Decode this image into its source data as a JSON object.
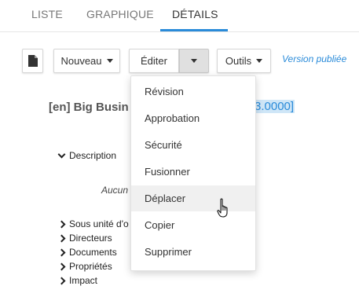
{
  "tabs": [
    {
      "label": "LISTE"
    },
    {
      "label": "GRAPHIQUE"
    },
    {
      "label": "DÉTAILS",
      "active": true
    }
  ],
  "toolbar": {
    "doc_icon": "document-icon",
    "new_label": "Nouveau",
    "edit_label": "Éditer",
    "tools_label": "Outils",
    "status_label": "Version publiée"
  },
  "document": {
    "title_visible": "[en] Big Busin",
    "code_visible": "3.0000]"
  },
  "sections": {
    "description": "Description",
    "empty_text_visible": "Aucun",
    "sub_unit_visible": "Sous unité d'o",
    "directors": "Directeurs",
    "documents": "Documents",
    "properties": "Propriétés",
    "impact": "Impact"
  },
  "edit_menu": {
    "items": [
      {
        "label": "Révision"
      },
      {
        "label": "Approbation"
      },
      {
        "label": "Sécurité"
      },
      {
        "label": "Fusionner"
      },
      {
        "label": "Déplacer",
        "hovered": true
      },
      {
        "label": "Copier"
      },
      {
        "label": "Supprimer"
      }
    ]
  },
  "colors": {
    "accent": "#2a8bd9",
    "hover_bg": "#f0f0f0",
    "selection_bg": "#cfe6f7"
  }
}
